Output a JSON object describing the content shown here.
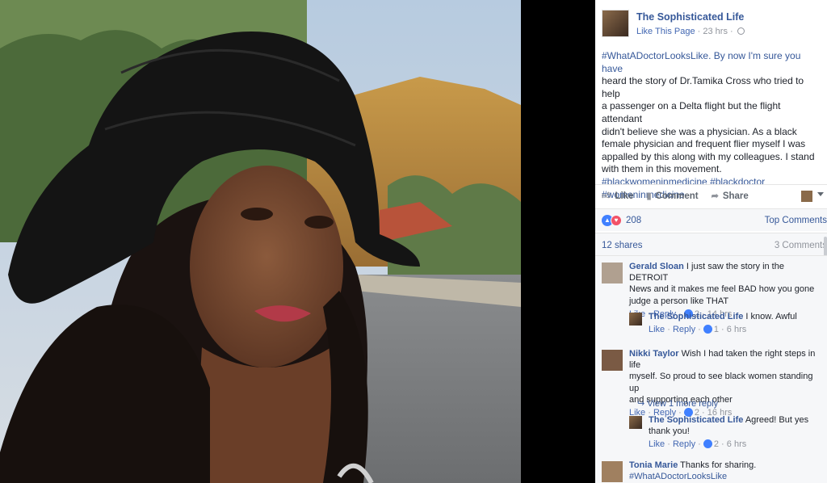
{
  "post": {
    "page_name": "The Sophisticated Life",
    "like_page": "Like This Page",
    "time": "23 hrs",
    "text_lines": [
      "#WhatADoctorLooksLike. By now I'm sure you have",
      "heard the story of Dr.Tamika Cross who tried to help",
      "a passenger on a Delta flight but the flight attendant",
      "didn't believe she was a physician. As a black",
      "female physician and frequent flier myself I was",
      "appalled by this along with my colleagues. I stand",
      "with them in this movement."
    ],
    "tags": [
      "#blackwomeninmedicine",
      "#blackdoctor",
      "#womeninmedicine"
    ]
  },
  "actions": {
    "like": "Like",
    "comment": "Comment",
    "share": "Share"
  },
  "icons": {
    "like": "thumbs-up-icon",
    "comment": "comment-icon",
    "share": "share-arrow-icon",
    "globe": "globe-icon",
    "reply_arrow": "reply-arrow-icon"
  },
  "reactions": {
    "count": "208",
    "sort": "Top Comments"
  },
  "shares": "12 shares",
  "comments_count": "3 Comments",
  "comments": [
    {
      "author": "Gerald Sloan",
      "text_first": "I just saw the story in the DETROIT",
      "text_lines": [
        "News and it makes me feel BAD how you gone",
        "judge a person like THAT"
      ],
      "like": "Like",
      "reply": "Reply",
      "reactions": "2",
      "time": "14 hrs",
      "replies": [
        {
          "author": "The Sophisticated Life",
          "text": "I know. Awful",
          "like": "Like",
          "reply": "Reply",
          "reactions": "1",
          "time": "6 hrs"
        }
      ]
    },
    {
      "author": "Nikki Taylor",
      "text_first": "Wish I had taken the right steps in life",
      "text_lines": [
        "myself. So proud to see black women standing up",
        "and supporting each other"
      ],
      "like": "Like",
      "reply": "Reply",
      "reactions": "2",
      "time": "16 hrs",
      "view_more": "View 1 more reply",
      "replies": [
        {
          "author": "The Sophisticated Life",
          "text": "Agreed! But yes",
          "text2": "thank you!",
          "like": "Like",
          "reply": "Reply",
          "reactions": "2",
          "time": "6 hrs"
        }
      ]
    },
    {
      "author": "Tonia Marie",
      "text_first": "Thanks for sharing.",
      "tag": "#WhatADoctorLooksLike"
    }
  ]
}
